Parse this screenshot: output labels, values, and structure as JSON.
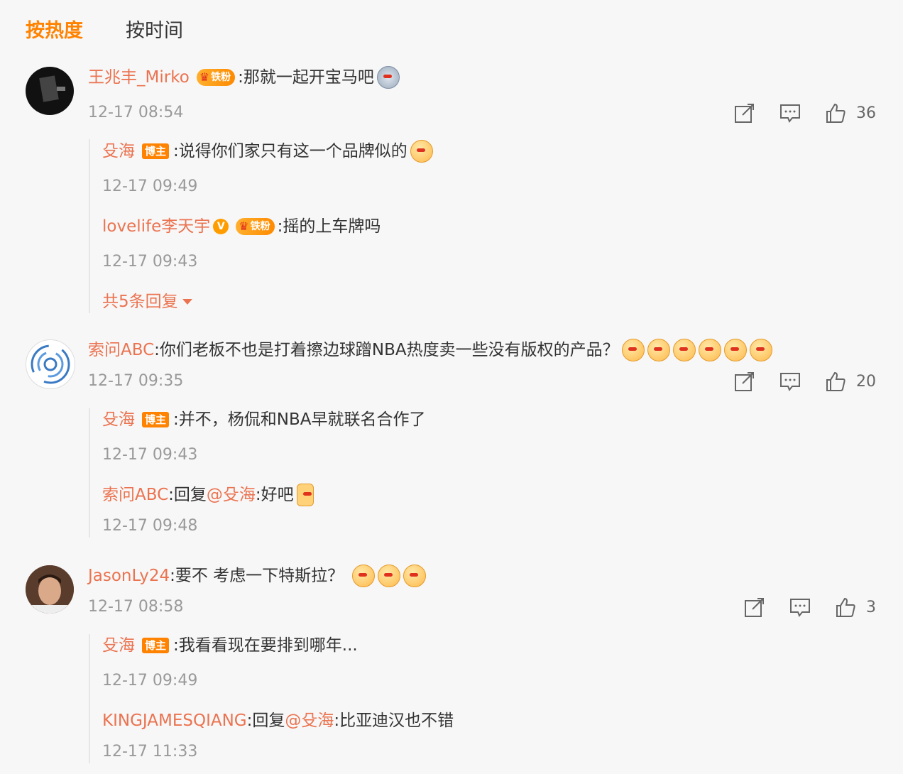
{
  "tabs": {
    "hot": "按热度",
    "time": "按时间"
  },
  "comments": [
    {
      "user": "王兆丰_Mirko",
      "fan_badge": "铁粉",
      "text": ":那就一起开宝马吧",
      "time": "12-17 08:54",
      "likes": "36",
      "replies": [
        {
          "user": "殳海",
          "badge": "博主",
          "text": ":说得你们家只有这一个品牌似的",
          "time": "12-17 09:49"
        },
        {
          "user": "lovelife李天宇",
          "fan_badge": "铁粉",
          "text": ":摇的上车牌吗",
          "time": "12-17 09:43"
        }
      ],
      "more_replies": "共5条回复"
    },
    {
      "user": "索问ABC",
      "text": ":你们老板不也是打着擦边球蹭NBA热度卖一些没有版权的产品？",
      "time": "12-17 09:35",
      "likes": "20",
      "replies": [
        {
          "user": "殳海",
          "badge": "博主",
          "text": ":并不，杨侃和NBA早就联名合作了",
          "time": "12-17 09:43"
        },
        {
          "user": "索问ABC",
          "reply_prefix": ":回复",
          "at": "@殳海",
          "text": ":好吧",
          "time": "12-17 09:48"
        }
      ]
    },
    {
      "user": "JasonLy24",
      "text": ":要不 考虑一下特斯拉？",
      "time": "12-17 08:58",
      "likes": "3",
      "replies": [
        {
          "user": "殳海",
          "badge": "博主",
          "text": ":我看看现在要排到哪年...",
          "time": "12-17 09:49"
        },
        {
          "user": "KINGJAMESQIANG",
          "reply_prefix": ":回复",
          "at": "@殳海",
          "text": ":比亚迪汉也不错",
          "time": "12-17 11:33"
        }
      ]
    }
  ],
  "colors": {
    "accent": "#ff8200",
    "username": "#eb7350",
    "meta": "#999999"
  },
  "icons": [
    "share-icon",
    "comment-icon",
    "like-icon",
    "verified-icon",
    "crown-icon"
  ]
}
